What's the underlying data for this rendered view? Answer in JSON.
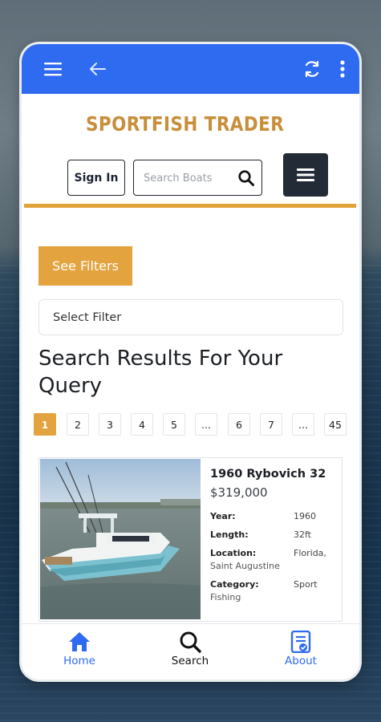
{
  "brand": {
    "name": "SPORTFISH TRADER",
    "color": "#c88e3a"
  },
  "appbar": {
    "color": "#2f6bf0",
    "icons": [
      "hamburger-menu-icon",
      "back-arrow-icon",
      "refresh-icon",
      "more-vert-icon"
    ]
  },
  "header": {
    "signin_label": "Sign In",
    "search_placeholder": "Search Boats",
    "menu_icon": "hamburger-menu-icon"
  },
  "filters": {
    "see_filters_label": "See Filters",
    "select_filter_label": "Select Filter"
  },
  "results": {
    "title": "Search Results For Your Query",
    "pagination": [
      "1",
      "2",
      "3",
      "4",
      "5",
      "...",
      "6",
      "7",
      "...",
      "45"
    ],
    "current_page": "1"
  },
  "listing": {
    "name": "1960 Rybovich 32",
    "price": "$319,000",
    "specs": [
      {
        "label": "Year:",
        "value": "1960",
        "cont": ""
      },
      {
        "label": "Length:",
        "value": "32ft",
        "cont": ""
      },
      {
        "label": "Location:",
        "value": "Florida,",
        "cont": "Saint Augustine"
      },
      {
        "label": "Category:",
        "value": "Sport",
        "cont": "Fishing"
      }
    ]
  },
  "bottom_nav": {
    "items": [
      {
        "label": "Home",
        "icon": "home-icon",
        "color": "#2f6bf0"
      },
      {
        "label": "Search",
        "icon": "search-icon",
        "color": "#111111"
      },
      {
        "label": "About",
        "icon": "about-document-icon",
        "color": "#2f6bf0"
      }
    ]
  },
  "colors": {
    "accent": "#e3a33f",
    "dark": "#232b37"
  }
}
